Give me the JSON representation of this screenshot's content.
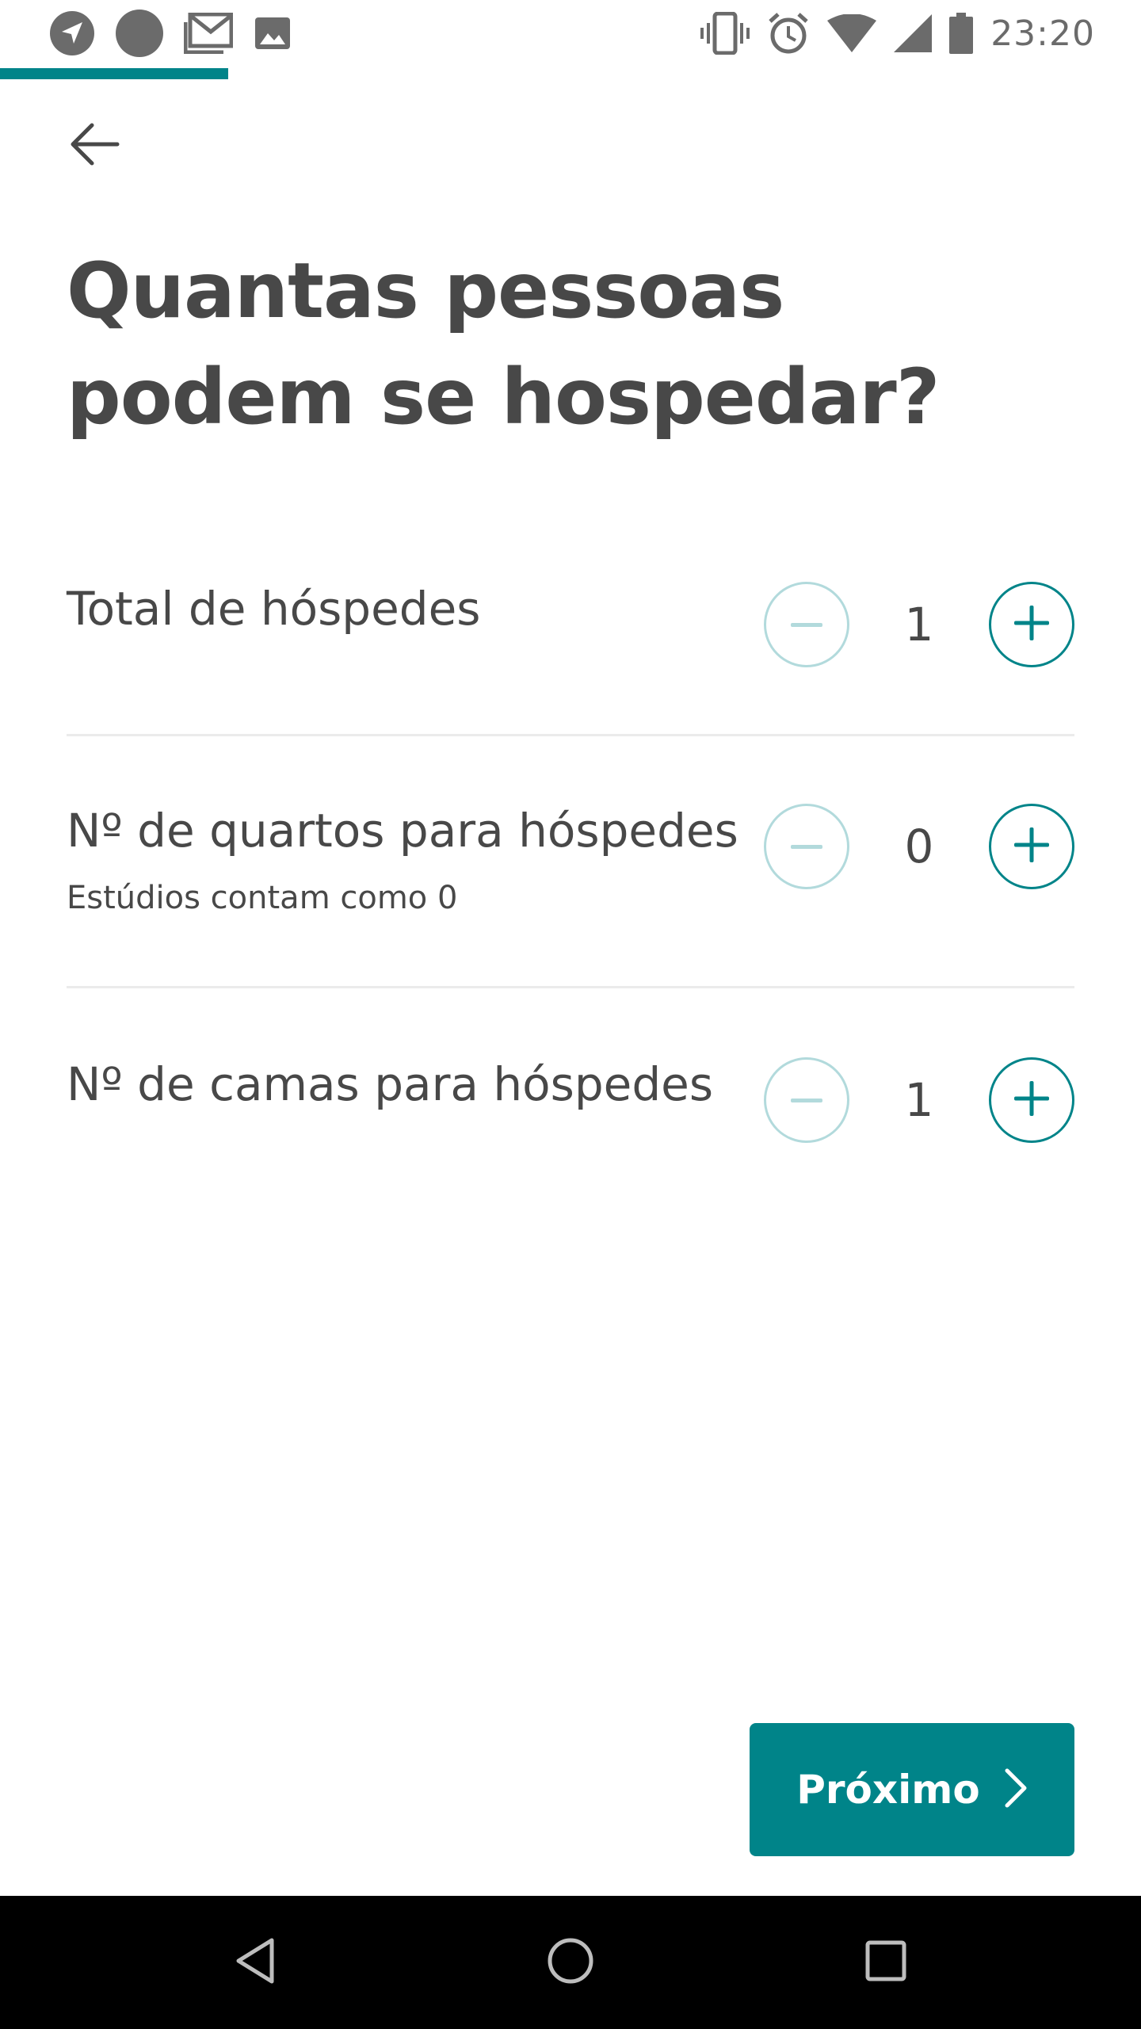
{
  "status_bar": {
    "time": "23:20",
    "left_icons": [
      "navigation-icon",
      "circle-notification-icon",
      "gmail-icon",
      "image-icon"
    ],
    "right_icons": [
      "vibrate-icon",
      "alarm-icon",
      "wifi-icon",
      "cell-signal-icon",
      "battery-icon"
    ]
  },
  "progress": {
    "fraction": 0.2,
    "color": "#008489"
  },
  "header": {
    "back_icon": "arrow-left-icon",
    "title": "Quantas pessoas podem se hospedar?"
  },
  "rows": [
    {
      "label": "Total de hóspedes",
      "sublabel": "",
      "value": "1",
      "minus_enabled": false,
      "plus_enabled": true
    },
    {
      "label": "Nº de quartos para hóspedes",
      "sublabel": "Estúdios contam como 0",
      "value": "0",
      "minus_enabled": false,
      "plus_enabled": true
    },
    {
      "label": "Nº de camas para hóspedes",
      "sublabel": "",
      "value": "1",
      "minus_enabled": false,
      "plus_enabled": true
    }
  ],
  "next_button": {
    "label": "Próximo",
    "icon": "chevron-right-icon"
  },
  "colors": {
    "accent": "#008489",
    "accent_disabled": "#b2dadc",
    "text": "#484848",
    "divider": "#ebebeb"
  },
  "nav_bar": {
    "items": [
      "back-triangle-icon",
      "home-circle-icon",
      "recents-square-icon"
    ]
  }
}
